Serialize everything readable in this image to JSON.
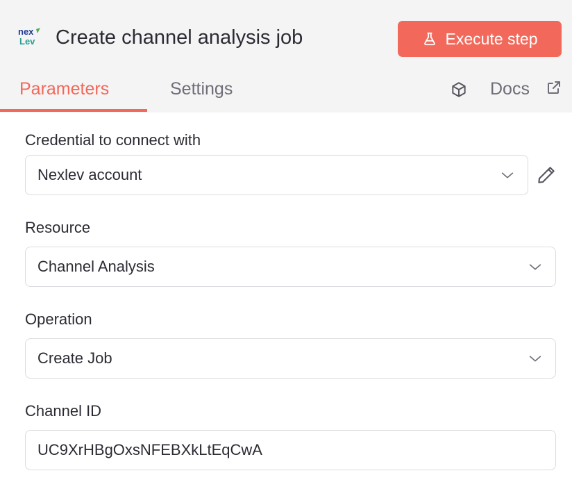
{
  "header": {
    "title": "Create channel analysis job",
    "logo_text_top": "nex",
    "logo_text_bottom": "Lev",
    "execute_label": "Execute step"
  },
  "tabs": [
    {
      "label": "Parameters",
      "active": true
    },
    {
      "label": "Settings",
      "active": false
    }
  ],
  "docs_label": "Docs",
  "form": {
    "credential": {
      "label": "Credential to connect with",
      "value": "Nexlev account"
    },
    "resource": {
      "label": "Resource",
      "value": "Channel Analysis"
    },
    "operation": {
      "label": "Operation",
      "value": "Create Job"
    },
    "channel_id": {
      "label": "Channel ID",
      "value": "UC9XrHBgOxsNFEBXkLtEqCwA"
    }
  },
  "colors": {
    "accent": "#f2685a",
    "header_bg": "#f4f4f5",
    "text": "#2b2b33",
    "muted": "#6e6e78",
    "border": "#dcdce0"
  }
}
